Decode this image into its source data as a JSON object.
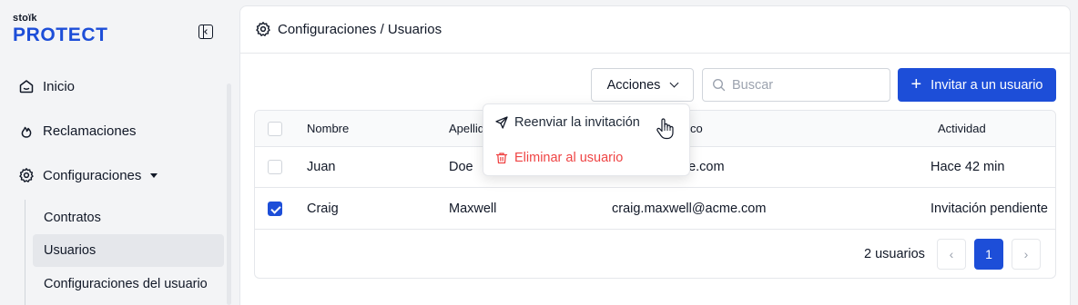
{
  "brand": {
    "top": "stoïk",
    "name": "PROTECT"
  },
  "sidebar": {
    "items": [
      {
        "label": "Inicio",
        "icon": "home-icon"
      },
      {
        "label": "Reclamaciones",
        "icon": "flame-icon"
      },
      {
        "label": "Configuraciones",
        "icon": "gear-icon"
      }
    ],
    "subitems": [
      {
        "label": "Contratos"
      },
      {
        "label": "Usuarios",
        "active": true
      },
      {
        "label": "Configuraciones del usuario"
      }
    ]
  },
  "header": {
    "breadcrumb": "Configuraciones / Usuarios"
  },
  "toolbar": {
    "actions_label": "Acciones",
    "search_placeholder": "Buscar",
    "invite_label": "Invitar a un usuario"
  },
  "table": {
    "columns": [
      "Nombre",
      "Apellido",
      "co",
      "Actividad"
    ],
    "rows": [
      {
        "nombre": "Juan",
        "apellido": "Doe",
        "email": "ne.com",
        "actividad": "Hace 42 min",
        "checked": false
      },
      {
        "nombre": "Craig",
        "apellido": "Maxwell",
        "email": "craig.maxwell@acme.com",
        "actividad": "Invitación pendiente",
        "checked": true
      }
    ]
  },
  "pagination": {
    "count_label": "2 usuarios",
    "current_page": "1",
    "prev": "‹",
    "next": "›"
  },
  "menu": {
    "resend_label": "Reenviar la invitación",
    "delete_label": "Eliminar al usuario"
  },
  "colors": {
    "primary": "#1d4ed8",
    "danger": "#ef4444",
    "sidebar_bg": "#f3f4f6"
  }
}
